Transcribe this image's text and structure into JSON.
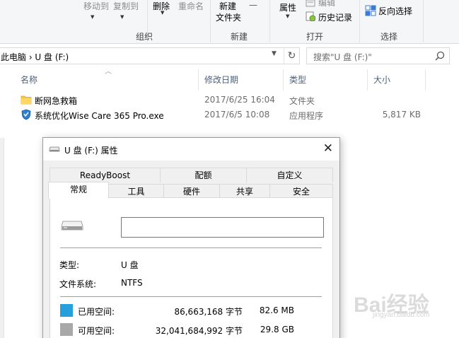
{
  "ribbon": {
    "move_to": "移动到",
    "copy_to": "复制到",
    "delete": "删除",
    "rename": "重命名",
    "new_folder_line1": "新建",
    "new_folder_line2": "文件夹",
    "properties": "属性",
    "edit_partial": "编辑",
    "history": "历史记录",
    "invert_selection": "反向选择",
    "group_organize": "组织",
    "group_new": "新建",
    "group_open": "打开",
    "group_select": "选择"
  },
  "address": {
    "path": "此电脑 › U 盘 (F:)",
    "search_placeholder": "搜索\"U 盘 (F:)\""
  },
  "columns": {
    "name": "名称",
    "modified": "修改日期",
    "type": "类型",
    "size": "大小"
  },
  "files": [
    {
      "name": "断网急救箱",
      "modified": "2017/6/25 16:04",
      "type": "文件夹",
      "size": "",
      "icon": "folder-icon"
    },
    {
      "name": "系统优化Wise Care 365 Pro.exe",
      "modified": "2017/6/5 10:08",
      "type": "应用程序",
      "size": "5,817 KB",
      "icon": "shield-app-icon"
    }
  ],
  "dialog": {
    "title": "U 盘 (F:) 属性",
    "tabs_back": [
      "ReadyBoost",
      "配额",
      "自定义"
    ],
    "tabs_front": [
      "常规",
      "工具",
      "硬件",
      "共享",
      "安全"
    ],
    "active_tab": "常规",
    "volume_label_value": "",
    "type_label": "类型:",
    "type_value": "U 盘",
    "fs_label": "文件系统:",
    "fs_value": "NTFS",
    "used_label": "已用空间:",
    "used_bytes": "86,663,168 字节",
    "used_human": "82.6 MB",
    "free_label": "可用空间:",
    "free_bytes": "32,041,684,992 字节",
    "free_human": "29.8 GB",
    "used_color": "#26a0da",
    "free_color": "#a8a8a8"
  },
  "watermark": {
    "brand": "Bai经验",
    "url": "jingyan.baidu.com"
  }
}
